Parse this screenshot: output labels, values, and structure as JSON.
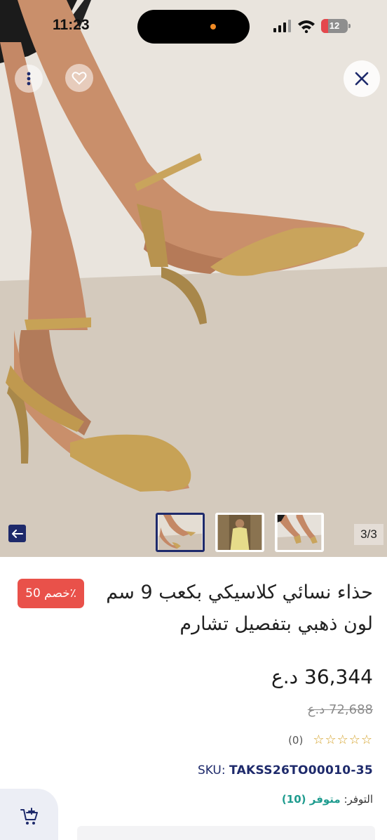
{
  "status_bar": {
    "time": "11:23",
    "battery": "12"
  },
  "gallery": {
    "counter": "3/3",
    "thumbnail_count": 3,
    "active_thumbnail": 1
  },
  "product": {
    "discount_badge": "خصم 50٪",
    "title": "حذاء نسائي كلاسيكي بكعب 9 سم لون ذهبي بتفصيل تشارم",
    "price": "36,344 د.ع",
    "old_price": "72,688 د.ع",
    "rating_stars": "☆☆☆☆☆",
    "review_count": "(0)",
    "sku_label": "SKU:",
    "sku_value": "TAKSS26TO00010-35",
    "availability_label": "التوفر:",
    "availability_value": "متوفر (10)"
  },
  "icons": {
    "more": "vertical-dots-icon",
    "favorite": "heart-icon",
    "close": "close-icon",
    "back": "arrow-left-icon",
    "cart": "add-to-cart-icon"
  },
  "colors": {
    "accent_navy": "#1e2a6b",
    "discount_red": "#e9514a",
    "availability_green": "#1f9c8f",
    "star_gold": "#d4a22a"
  }
}
